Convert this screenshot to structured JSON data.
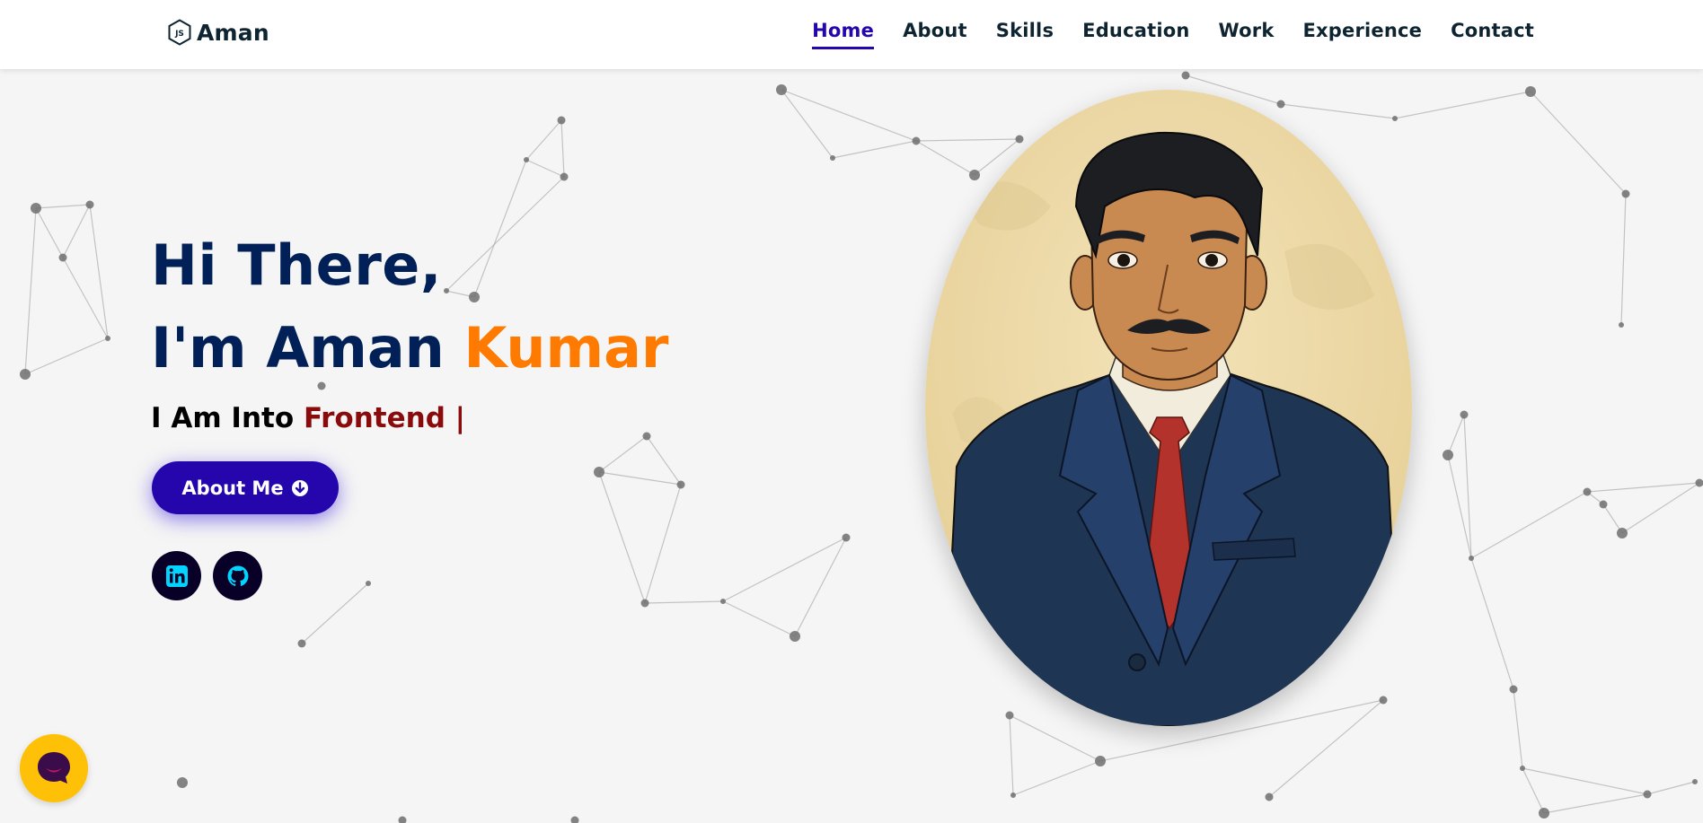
{
  "header": {
    "logo_text": "Aman",
    "logo_icon": "nodejs-hexagon-icon",
    "nav": [
      {
        "label": "Home",
        "active": true
      },
      {
        "label": "About",
        "active": false
      },
      {
        "label": "Skills",
        "active": false
      },
      {
        "label": "Education",
        "active": false
      },
      {
        "label": "Work",
        "active": false
      },
      {
        "label": "Experience",
        "active": false
      },
      {
        "label": "Contact",
        "active": false
      }
    ]
  },
  "hero": {
    "greeting": "Hi There,",
    "name_prefix": "I'm Aman ",
    "name_accent": "Kumar",
    "typing_prefix": "I Am Into ",
    "typing_word": "Frontend",
    "typing_cursor": " |",
    "cta_label": "About Me",
    "cta_icon": "arrow-circle-down-icon",
    "social": [
      {
        "name": "linkedin",
        "icon": "linkedin-icon"
      },
      {
        "name": "github",
        "icon": "github-icon"
      }
    ]
  },
  "chat": {
    "icon": "chat-smile-icon"
  },
  "colors": {
    "nav_active": "#2506ad",
    "heading": "#002057",
    "accent_orange": "#ff7a00",
    "typing_red": "#8a0b0b",
    "button": "#2506ad",
    "social_bg": "#080026",
    "social_icon": "#00d4ff",
    "chat_bg": "#ffc107",
    "background": "#f5f5f5"
  }
}
